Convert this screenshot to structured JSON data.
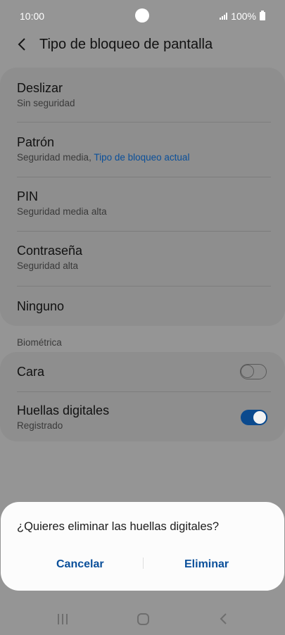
{
  "status_bar": {
    "time": "10:00",
    "battery": "100%"
  },
  "header": {
    "title": "Tipo de bloqueo de pantalla"
  },
  "lock_options": [
    {
      "title": "Deslizar",
      "subtitle": "Sin seguridad"
    },
    {
      "title": "Patrón",
      "subtitle": "Seguridad media,",
      "subtitle_link": "Tipo de bloqueo actual"
    },
    {
      "title": "PIN",
      "subtitle": "Seguridad media alta"
    },
    {
      "title": "Contraseña",
      "subtitle": "Seguridad alta"
    },
    {
      "title": "Ninguno"
    }
  ],
  "biometrics": {
    "section_label": "Biométrica",
    "items": [
      {
        "title": "Cara",
        "enabled": false
      },
      {
        "title": "Huellas digitales",
        "subtitle": "Registrado",
        "enabled": true
      }
    ]
  },
  "dialog": {
    "message": "¿Quieres eliminar las huellas digitales?",
    "cancel_label": "Cancelar",
    "confirm_label": "Eliminar"
  },
  "colors": {
    "accent": "#0a4f9a",
    "toggle_on": "#0b4a8e",
    "scrim_background": "#959595",
    "dialog_background": "#fcfcfc"
  },
  "icons": {
    "header_back": "chevron-left-icon",
    "nav_recents": "recents-icon",
    "nav_home": "home-icon",
    "nav_back": "back-icon"
  }
}
